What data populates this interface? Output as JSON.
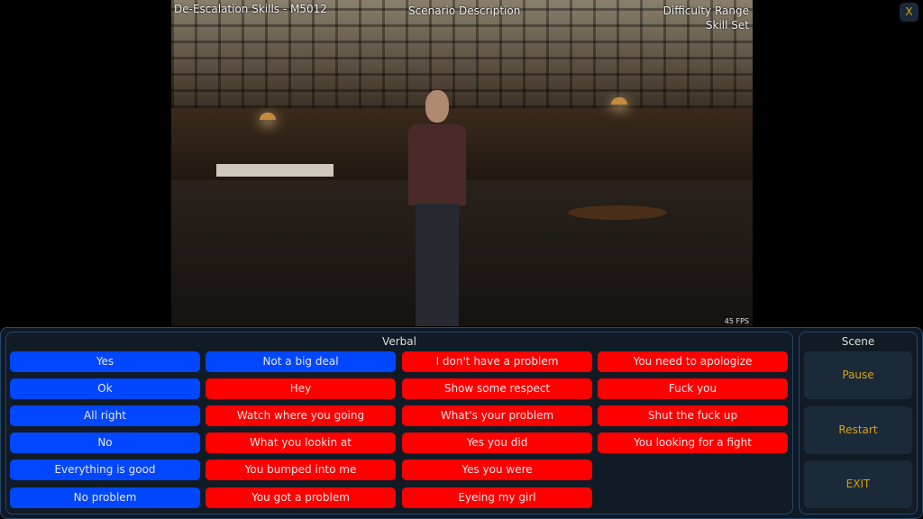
{
  "header": {
    "title": "De-Escalation Skills - M5012",
    "scenario": "Scenario Description",
    "difficulty": "Difficulty Range",
    "skill_set": "Skill Set",
    "close_label": "X"
  },
  "viewport": {
    "fps": "45 FPS"
  },
  "verbal": {
    "title": "Verbal",
    "columns": [
      [
        {
          "label": "Yes",
          "tone": "blue"
        },
        {
          "label": "Ok",
          "tone": "blue"
        },
        {
          "label": "All right",
          "tone": "blue"
        },
        {
          "label": "No",
          "tone": "blue"
        },
        {
          "label": "Everything is good",
          "tone": "blue"
        },
        {
          "label": "No problem",
          "tone": "blue"
        }
      ],
      [
        {
          "label": "Not a big deal",
          "tone": "blue"
        },
        {
          "label": "Hey",
          "tone": "red"
        },
        {
          "label": "Watch where you going",
          "tone": "red"
        },
        {
          "label": "What you lookin at",
          "tone": "red"
        },
        {
          "label": "You bumped into me",
          "tone": "red"
        },
        {
          "label": "You got a problem",
          "tone": "red"
        }
      ],
      [
        {
          "label": "I don't have a problem",
          "tone": "red"
        },
        {
          "label": "Show some respect",
          "tone": "red"
        },
        {
          "label": "What's your problem",
          "tone": "red"
        },
        {
          "label": "Yes you did",
          "tone": "red"
        },
        {
          "label": "Yes you were",
          "tone": "red"
        },
        {
          "label": "Eyeing my girl",
          "tone": "red"
        }
      ],
      [
        {
          "label": "You need to apologize",
          "tone": "red"
        },
        {
          "label": "Fuck you",
          "tone": "red"
        },
        {
          "label": "Shut the fuck up",
          "tone": "red"
        },
        {
          "label": "You looking for a fight",
          "tone": "red"
        }
      ]
    ]
  },
  "scene": {
    "title": "Scene",
    "buttons": [
      "Pause",
      "Restart",
      "EXIT"
    ]
  },
  "colors": {
    "blue": "#0047ff",
    "red": "#ff0000",
    "accent": "#d4a017"
  }
}
